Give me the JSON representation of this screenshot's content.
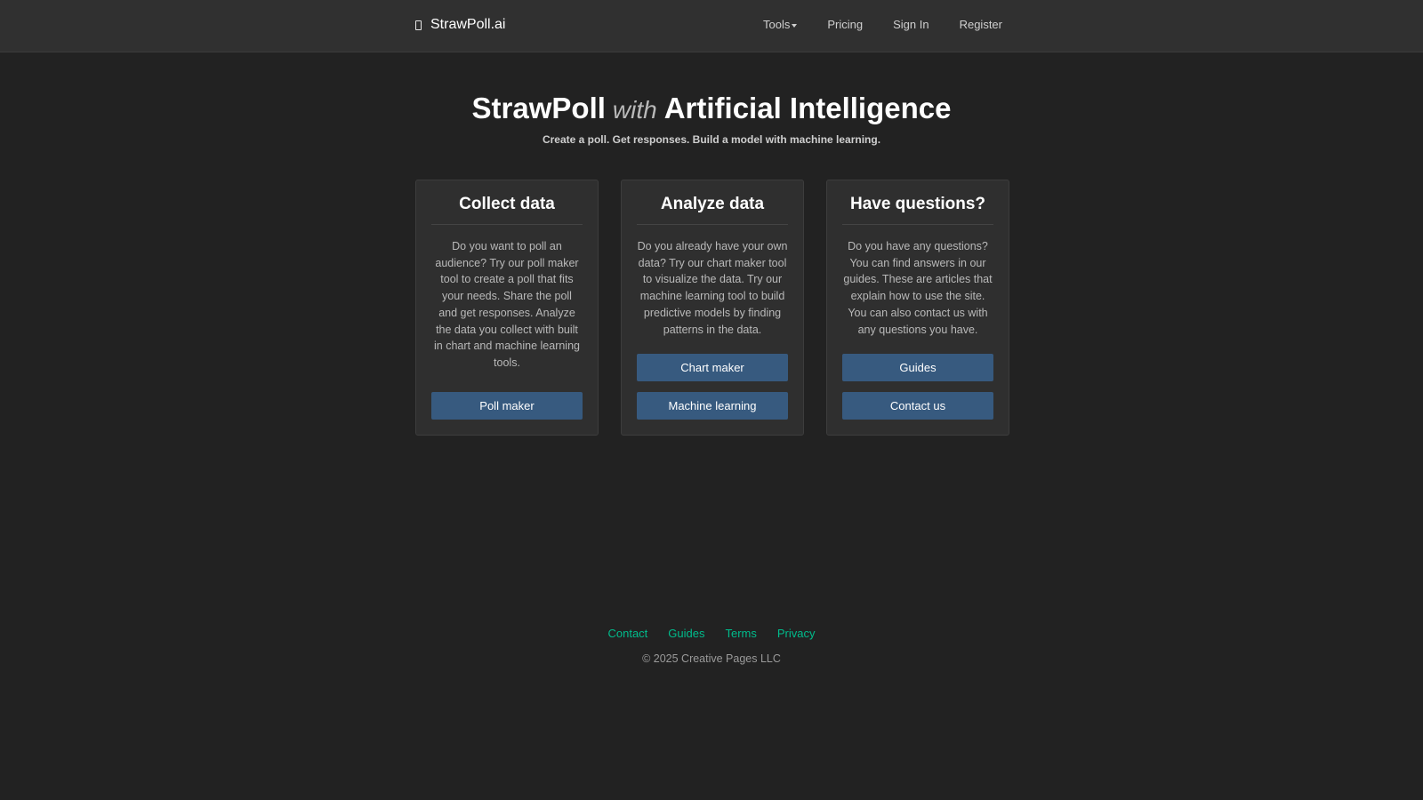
{
  "nav": {
    "brand": "StrawPoll.ai",
    "brand_icon": "phone-icon",
    "links": [
      {
        "label": "Tools",
        "has_caret": true
      },
      {
        "label": "Pricing"
      },
      {
        "label": "Sign In"
      },
      {
        "label": "Register"
      }
    ]
  },
  "hero": {
    "title_part1": "StrawPoll",
    "title_with": "with",
    "title_part2": "Artificial Intelligence",
    "subtitle": "Create a poll. Get responses. Build a model with machine learning."
  },
  "cards": [
    {
      "title": "Collect data",
      "text": "Do you want to poll an audience? Try our poll maker tool to create a poll that fits your needs. Share the poll and get responses. Analyze the data you collect with built in chart and machine learning tools.",
      "buttons": [
        "Poll maker"
      ]
    },
    {
      "title": "Analyze data",
      "text": "Do you already have your own data? Try our chart maker tool to visualize the data. Try our machine learning tool to build predictive models by finding patterns in the data.",
      "buttons": [
        "Chart maker",
        "Machine learning"
      ]
    },
    {
      "title": "Have questions?",
      "text": "Do you have any questions? You can find answers in our guides. These are articles that explain how to use the site. You can also contact us with any questions you have.",
      "buttons": [
        "Guides",
        "Contact us"
      ]
    }
  ],
  "footer": {
    "links": [
      "Contact",
      "Guides",
      "Terms",
      "Privacy"
    ],
    "copyright": "© 2025 Creative Pages LLC"
  },
  "colors": {
    "background": "#222222",
    "navbar": "#303030",
    "card": "#2f2f2f",
    "button": "#375a7f",
    "footer_link": "#00bc8c"
  }
}
